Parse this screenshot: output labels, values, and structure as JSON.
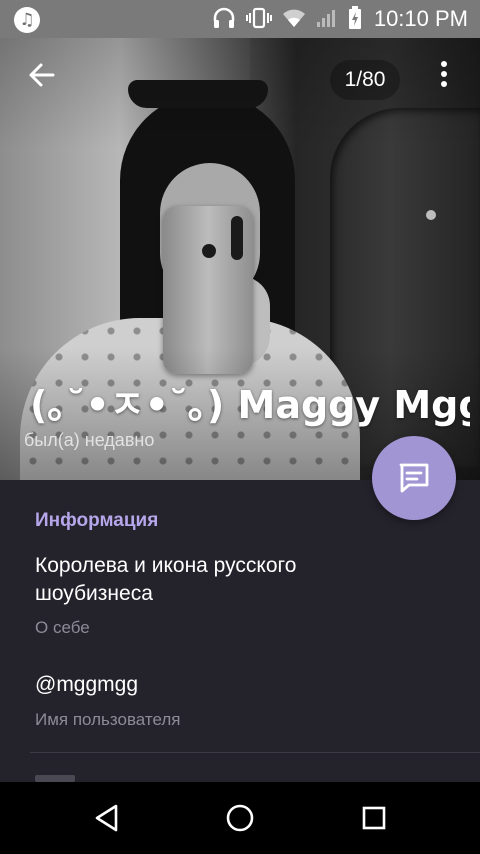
{
  "status_bar": {
    "time": "10:10 PM",
    "icons": [
      "music-note-icon",
      "headphones-icon",
      "vibrate-icon",
      "wifi-icon",
      "signal-icon",
      "battery-icon"
    ]
  },
  "photo_viewer": {
    "counter": "1/80",
    "profile_name": "(｡˘•ㅈ•˘｡) Maggy    Mgg",
    "last_seen": "был(а) недавно"
  },
  "info": {
    "heading": "Информация",
    "bio": "Королева и икона русского шоубизнеса",
    "bio_caption": "О себе",
    "username": "@mggmgg",
    "username_caption": "Имя пользователя"
  },
  "colors": {
    "accent": "#b6a6ea",
    "fab": "#a195d4",
    "background": "#24222b"
  }
}
